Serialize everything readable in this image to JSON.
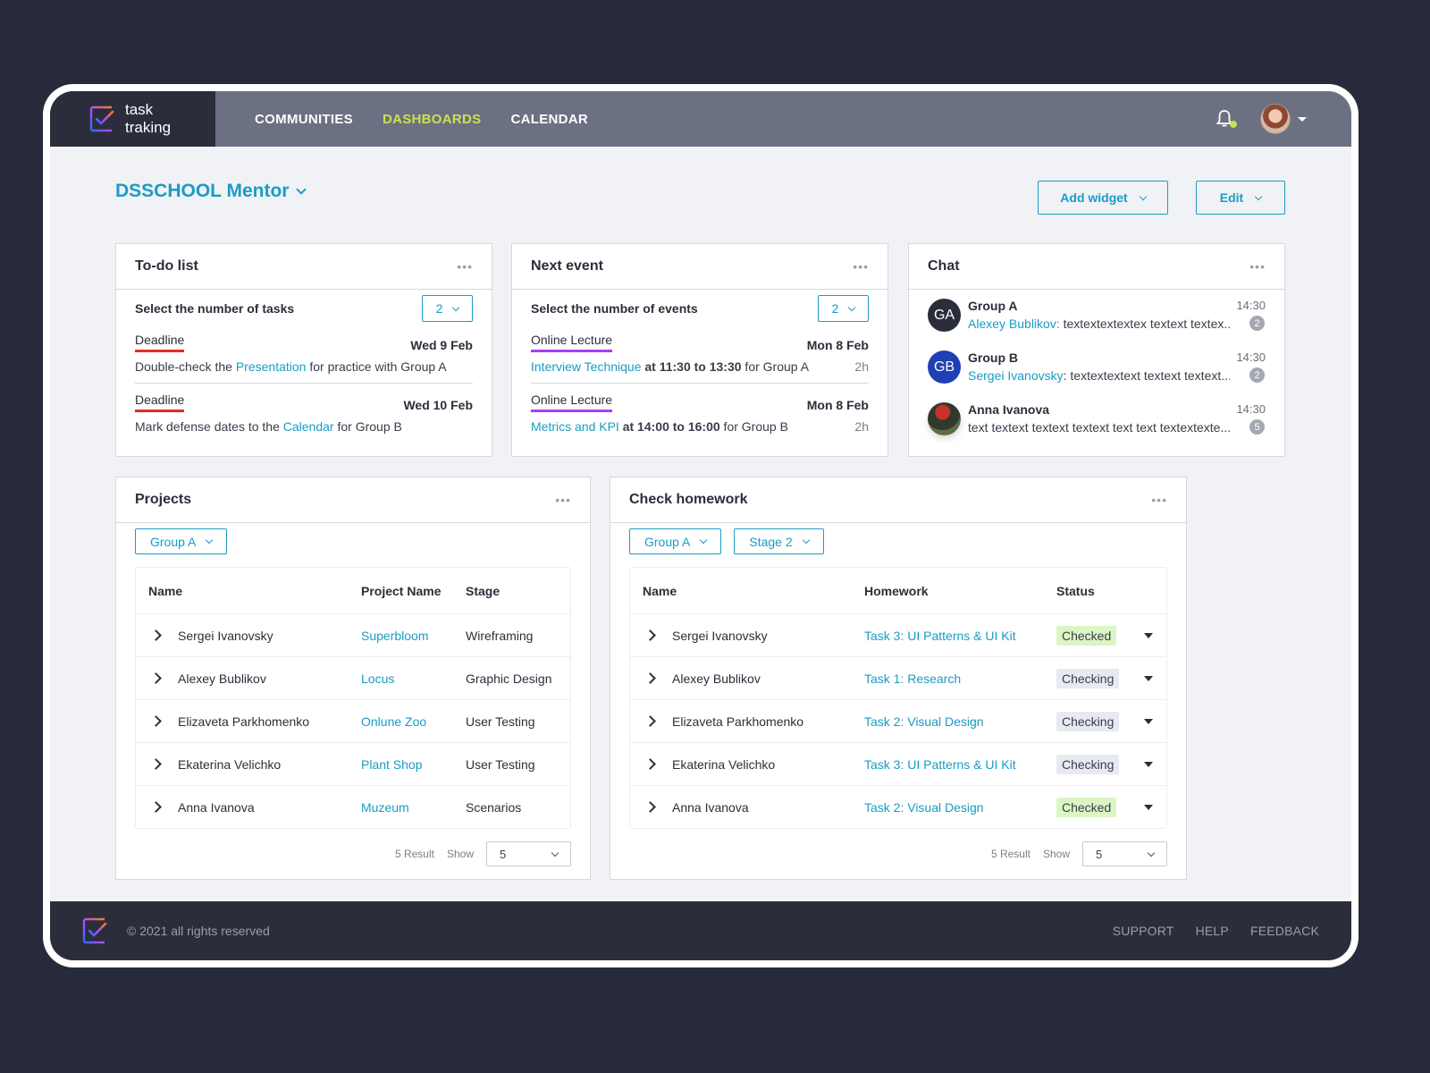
{
  "brand": {
    "line1": "task",
    "line2": "traking"
  },
  "nav": [
    {
      "label": "COMMUNITIES",
      "active": false
    },
    {
      "label": "DASHBOARDS",
      "active": true
    },
    {
      "label": "CALENDAR",
      "active": false
    }
  ],
  "icons": {
    "bell": "bell-icon",
    "avatar": "user-avatar",
    "logo": "checkbox-logo-icon"
  },
  "page": {
    "title": "DSSCHOOL Mentor",
    "add_widget": "Add widget",
    "edit": "Edit"
  },
  "todo": {
    "title": "To-do list",
    "menu": "•••",
    "select_label": "Select the number of tasks",
    "select_value": "2",
    "items": [
      {
        "tag": "Deadline",
        "date": "Wed 9 Feb",
        "pre": "Double-check the ",
        "link": "Presentation",
        "post": " for practice with Group A"
      },
      {
        "tag": "Deadline",
        "date": "Wed 10 Feb",
        "pre": "Mark defense dates to the ",
        "link": "Calendar",
        "post": " for Group B"
      }
    ]
  },
  "events": {
    "title": "Next event",
    "menu": "•••",
    "select_label": "Select the number of events",
    "select_value": "2",
    "items": [
      {
        "tag": "Online Lecture",
        "date": "Mon 8 Feb",
        "link": "Interview Technique",
        "time": " at 11:30 to 13:30",
        "post": " for Group A",
        "duration": "2h"
      },
      {
        "tag": "Online Lecture",
        "date": "Mon 8 Feb",
        "link": "Metrics and KPI",
        "time": " at 14:00 to 16:00",
        "post": " for Group B",
        "duration": "2h"
      }
    ]
  },
  "chat": {
    "title": "Chat",
    "menu": "•••",
    "items": [
      {
        "initials": "GA",
        "color": "#2b2d3b",
        "name": "Group A",
        "sender": "Alexey Bublikov:",
        "text": " textextextextex textext textex...",
        "time": "14:30",
        "unread": "2"
      },
      {
        "initials": "GB",
        "color": "#1f3fb4",
        "name": "Group B",
        "sender": "Sergei Ivanovsky",
        "text": ": textextextext textext textext...",
        "time": "14:30",
        "unread": "2"
      },
      {
        "initials": "",
        "color": "#3d4a3a",
        "name": "Anna Ivanova",
        "sender": "",
        "text": "text textext textext textext text text textextexte...",
        "time": "14:30",
        "unread": "5"
      }
    ]
  },
  "projects": {
    "title": "Projects",
    "menu": "•••",
    "filter": "Group A",
    "columns": [
      "Name",
      "Project Name",
      "Stage"
    ],
    "rows": [
      {
        "name": "Sergei Ivanovsky",
        "project": "Superbloom",
        "stage": "Wireframing"
      },
      {
        "name": "Alexey Bublikov",
        "project": "Locus",
        "stage": "Graphic Design"
      },
      {
        "name": "Elizaveta Parkhomenko",
        "project": "Onlune Zoo",
        "stage": "User Testing"
      },
      {
        "name": "Ekaterina Velichko",
        "project": "Plant Shop",
        "stage": "User Testing"
      },
      {
        "name": "Anna Ivanova",
        "project": "Muzeum",
        "stage": "Scenarios"
      }
    ],
    "result": "5 Result",
    "show_label": "Show",
    "show_value": "5"
  },
  "homework": {
    "title": "Check homework",
    "menu": "•••",
    "filters": [
      "Group A",
      "Stage 2"
    ],
    "columns": [
      "Name",
      "Homework",
      "Status"
    ],
    "rows": [
      {
        "name": "Sergei Ivanovsky",
        "task": "Task 3: UI Patterns & UI Kit",
        "status": "Checked"
      },
      {
        "name": "Alexey Bublikov",
        "task": "Task 1: Research",
        "status": "Checking"
      },
      {
        "name": "Elizaveta Parkhomenko",
        "task": "Task 2: Visual Design",
        "status": "Checking"
      },
      {
        "name": "Ekaterina Velichko",
        "task": "Task 3: UI Patterns & UI Kit",
        "status": "Checking"
      },
      {
        "name": "Anna Ivanova",
        "task": "Task 2: Visual Design",
        "status": "Checked"
      }
    ],
    "result": "5 Result",
    "show_label": "Show",
    "show_value": "5"
  },
  "footer": {
    "copyright": "© 2021 all rights reserved",
    "links": [
      "SUPPORT",
      "HELP",
      "FEEDBACK"
    ]
  },
  "colors": {
    "accent": "#1a9cc4",
    "nav_active": "#c9e24e",
    "deadline": "#e0301e",
    "lecture": "#a83ff0",
    "checked_bg": "#dcf5c4",
    "checking_bg": "#e8eaf2"
  }
}
